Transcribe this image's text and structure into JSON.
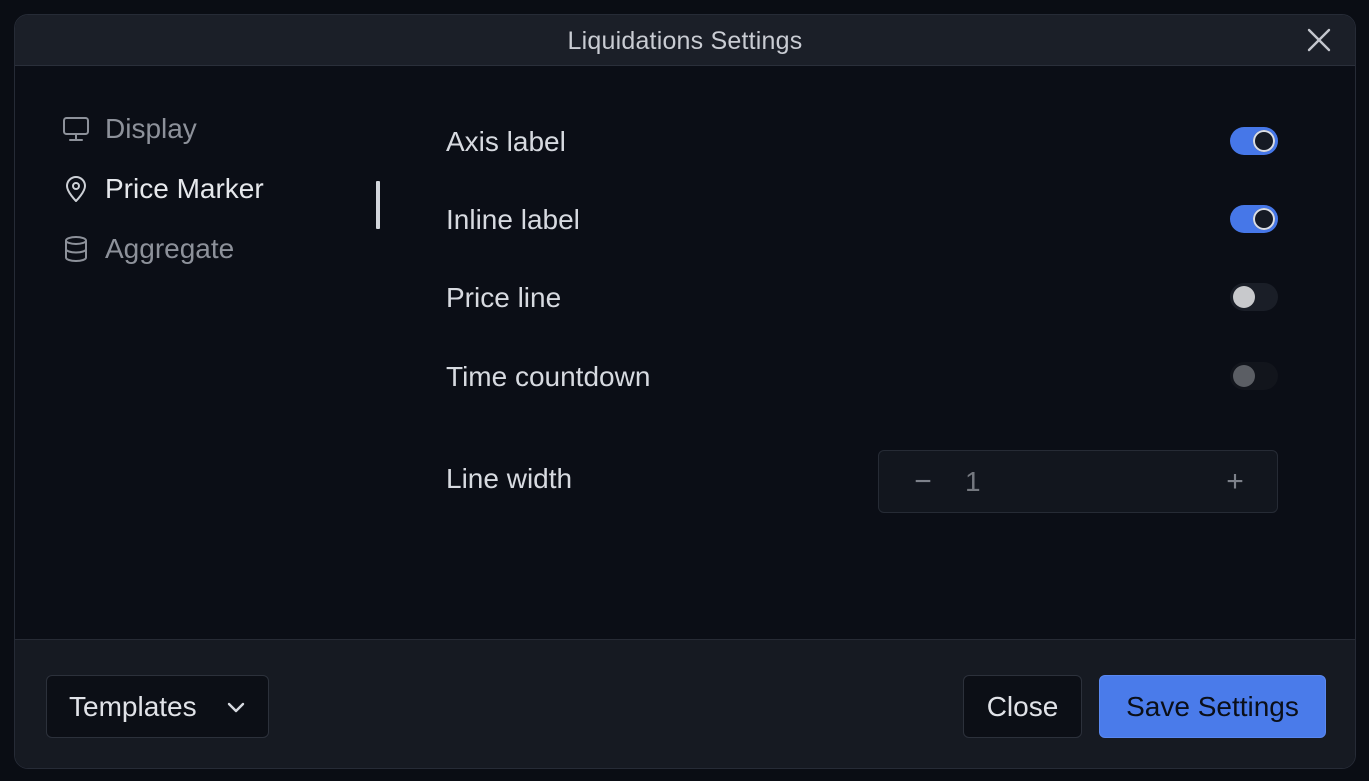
{
  "dialog": {
    "title": "Liquidations Settings",
    "close_icon": "close-icon"
  },
  "nav": {
    "items": [
      {
        "label": "Display",
        "icon": "monitor-icon",
        "active": false
      },
      {
        "label": "Price Marker",
        "icon": "map-pin-icon",
        "active": true
      },
      {
        "label": "Aggregate",
        "icon": "database-icon",
        "active": false
      }
    ]
  },
  "settings": {
    "axis_label": {
      "label": "Axis label",
      "enabled": true
    },
    "inline_label": {
      "label": "Inline label",
      "enabled": true
    },
    "price_line": {
      "label": "Price line",
      "enabled": false
    },
    "time_countdown": {
      "label": "Time countdown",
      "enabled": false,
      "disabled": true
    },
    "line_width": {
      "label": "Line width",
      "value": "1",
      "decrement_symbol": "−",
      "increment_symbol": "+"
    }
  },
  "footer": {
    "templates_label": "Templates",
    "close_label": "Close",
    "save_label": "Save Settings"
  },
  "colors": {
    "accent": "#4a7bea",
    "background": "#0b0e16",
    "titlebar": "#1b1f28",
    "footer": "#161a22"
  }
}
